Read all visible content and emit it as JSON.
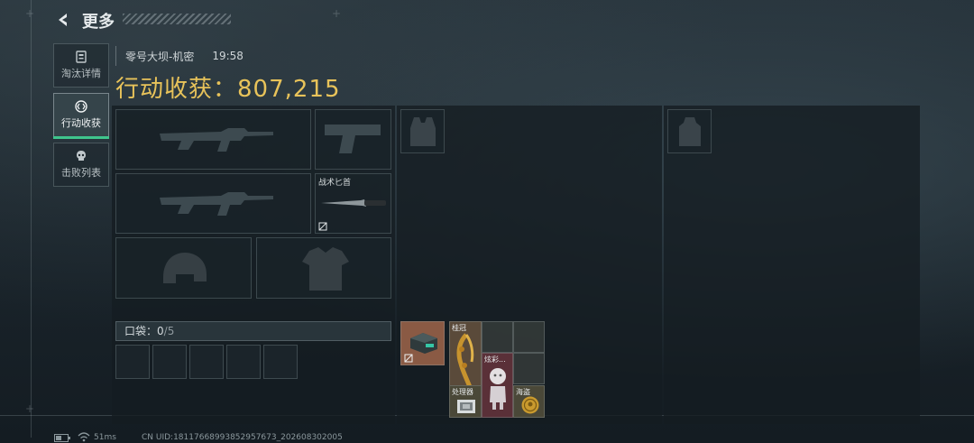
{
  "header": {
    "title": "更多"
  },
  "nav": {
    "tabs": [
      {
        "label": "淘汰详情",
        "icon": "document-icon",
        "active": false
      },
      {
        "label": "行动收获",
        "icon": "spoils-icon",
        "active": true
      },
      {
        "label": "击败列表",
        "icon": "skull-icon",
        "active": false
      }
    ]
  },
  "match": {
    "map": "零号大坝-机密",
    "time": "19:58",
    "earnings_label": "行动收获：",
    "earnings_value": "807,215"
  },
  "loadout": {
    "primary_weapon": "rifle-silhouette-icon",
    "secondary_weapon": "rifle-silhouette-icon",
    "pistol": "pistol-silhouette-icon",
    "melee": {
      "label": "战术匕首",
      "icon": "knife-icon",
      "badge": "no-drop-icon"
    },
    "helmet": "helmet-silhouette-icon",
    "armor": "armor-silhouette-icon"
  },
  "pocket": {
    "label": "口袋：",
    "count": "0",
    "capacity": "/5",
    "slots": 5
  },
  "backpack_items": [
    {
      "label": "",
      "icon": "ammo-box-icon",
      "color": "#8a5a44",
      "badge": "no-drop-icon"
    },
    {
      "label": "桂冠",
      "icon": "gold-laurel-icon",
      "color": "#5a4a3a"
    },
    {
      "label": "炫彩...",
      "icon": "figurine-icon",
      "color": "#5a3038"
    },
    {
      "label": "处理器",
      "icon": "processor-icon",
      "color": "#4a4838"
    },
    {
      "label": "海盗",
      "icon": "pirate-coin-icon",
      "color": "#4a4838"
    }
  ],
  "colors": {
    "accent_gold": "#e8c35a",
    "active_tab_underline": "#3fc58d",
    "rare_red": "#5a3038",
    "gold_bg": "#5a4a3a"
  },
  "status": {
    "ping": "51ms",
    "uid": "CN UID:18117668993852957673_202608302005"
  }
}
